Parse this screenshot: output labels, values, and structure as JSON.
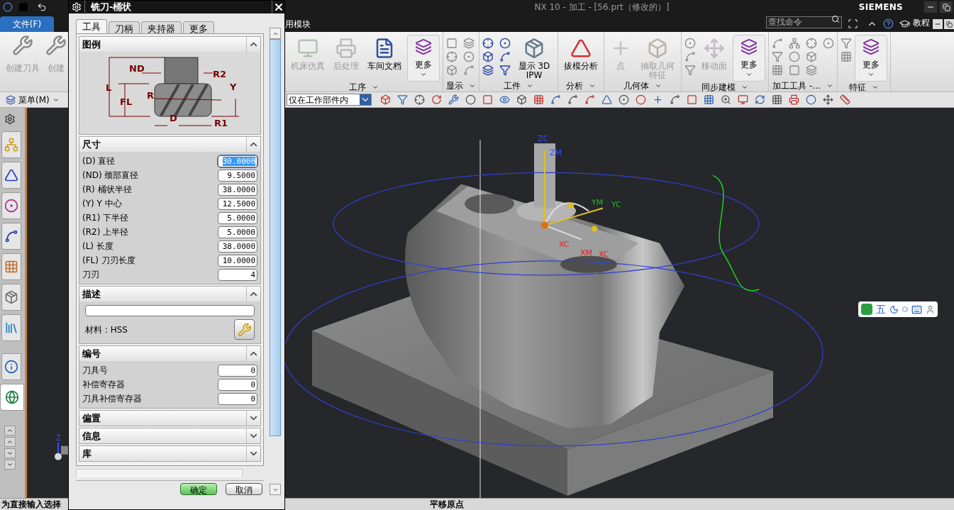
{
  "title_bar": {
    "title": "NX 10 - 加工 - [56.prt（修改的）]",
    "brand": "SIEMENS"
  },
  "menu_bar": {
    "file_tab": "文件(F)",
    "module_tab": "用模块",
    "search": {
      "placeholder": "查找命令"
    },
    "tutorial": "教程"
  },
  "ribbon": {
    "left_buttons": [
      {
        "label": "创建刀具",
        "disabled": true
      },
      {
        "label": "创建",
        "disabled": true
      }
    ],
    "groups": [
      {
        "label": "工序",
        "buttons": [
          {
            "label": "机床仿真",
            "kind": "big",
            "disabled": true
          },
          {
            "label": "后处理",
            "kind": "big",
            "disabled": true
          },
          {
            "label": "车间文档",
            "kind": "big",
            "disabled": false
          },
          {
            "label": "更多",
            "kind": "more",
            "disabled": false
          }
        ]
      },
      {
        "label": "显示"
      },
      {
        "label": "工件",
        "buttons": [
          {
            "label": "显示 3D IPW",
            "kind": "big",
            "disabled": false
          }
        ]
      },
      {
        "label": "分析",
        "buttons": [
          {
            "label": "拔模分析",
            "kind": "big",
            "disabled": false
          }
        ]
      },
      {
        "label": "几何体",
        "buttons": [
          {
            "label": "点",
            "kind": "big",
            "disabled": true
          },
          {
            "label": "抽取几何特征",
            "kind": "big",
            "disabled": true
          }
        ]
      },
      {
        "label": "同步建模",
        "buttons": [
          {
            "label": "移动面",
            "kind": "big",
            "disabled": true
          },
          {
            "label": "更多",
            "kind": "more",
            "disabled": false
          }
        ]
      },
      {
        "label": "加工工具 -..."
      },
      {
        "label": "特征",
        "buttons": [
          {
            "label": "更多",
            "kind": "more",
            "disabled": false
          }
        ]
      }
    ]
  },
  "toolbar": {
    "menu": "菜单(M)",
    "filter": "仅在工作部件内"
  },
  "sidebar": {
    "tabs": [
      {
        "selected": false
      },
      {
        "selected": false
      },
      {
        "selected": false
      },
      {
        "selected": false
      },
      {
        "selected": false
      },
      {
        "selected": false
      },
      {
        "selected": false
      },
      {
        "selected": false
      },
      {
        "selected": true
      }
    ]
  },
  "viewport": {
    "axis_labels": [
      {
        "text": "ZC",
        "color": "#3050ff"
      },
      {
        "text": "ZM",
        "color": "#3050ff"
      },
      {
        "text": "YM",
        "color": "#20c020"
      },
      {
        "text": "YC",
        "color": "#20c020"
      },
      {
        "text": "XC",
        "color": "#e02020"
      },
      {
        "text": "XM",
        "color": "#e02020"
      },
      {
        "text": "XC",
        "color": "#e02020"
      }
    ],
    "triad_label": "Z",
    "ime": "五"
  },
  "dialog": {
    "title": "铣刀-桶状",
    "tabs": [
      {
        "label": "工具",
        "selected": true
      },
      {
        "label": "刀柄",
        "selected": false
      },
      {
        "label": "夹持器",
        "selected": false
      },
      {
        "label": "更多",
        "selected": false
      }
    ],
    "sections": [
      {
        "kind": "legend",
        "title": "图例",
        "expanded": true,
        "labels": [
          "ND",
          "R2",
          "L",
          "FL",
          "R",
          "Y",
          "D",
          "R1"
        ]
      },
      {
        "kind": "fields",
        "title": "尺寸",
        "expanded": true,
        "rows": [
          {
            "label": "(D) 直径",
            "value": "30.0000",
            "selected": true
          },
          {
            "label": "(ND) 颈部直径",
            "value": "9.5000",
            "selected": false
          },
          {
            "label": "(R) 桶状半径",
            "value": "38.0000",
            "selected": false
          },
          {
            "label": "(Y) Y 中心",
            "value": "12.5000",
            "selected": false
          },
          {
            "label": "(R1) 下半径",
            "value": "5.0000",
            "selected": false
          },
          {
            "label": "(R2) 上半径",
            "value": "5.0000",
            "selected": false
          },
          {
            "label": "(L) 长度",
            "value": "38.0000",
            "selected": false
          },
          {
            "label": "(FL) 刀刃长度",
            "value": "10.0000",
            "selected": false
          },
          {
            "label": "刀刃",
            "value": "4",
            "selected": false
          }
        ]
      },
      {
        "kind": "description",
        "title": "描述",
        "expanded": true,
        "material": "材料 : HSS"
      },
      {
        "kind": "fields",
        "title": "编号",
        "expanded": true,
        "rows": [
          {
            "label": "刀具号",
            "value": "0",
            "selected": false
          },
          {
            "label": "补偿寄存器",
            "value": "0",
            "selected": false
          },
          {
            "label": "刀具补偿寄存器",
            "value": "0",
            "selected": false
          }
        ]
      },
      {
        "title": "偏置",
        "expanded": false
      },
      {
        "title": "信息",
        "expanded": false
      },
      {
        "title": "库",
        "expanded": false
      }
    ],
    "buttons": [
      {
        "label": "确定",
        "kind": "primary"
      },
      {
        "label": "取消",
        "kind": "secondary"
      }
    ]
  },
  "status_bar": {
    "left": "为直接输入选择",
    "center": "平移原点"
  }
}
